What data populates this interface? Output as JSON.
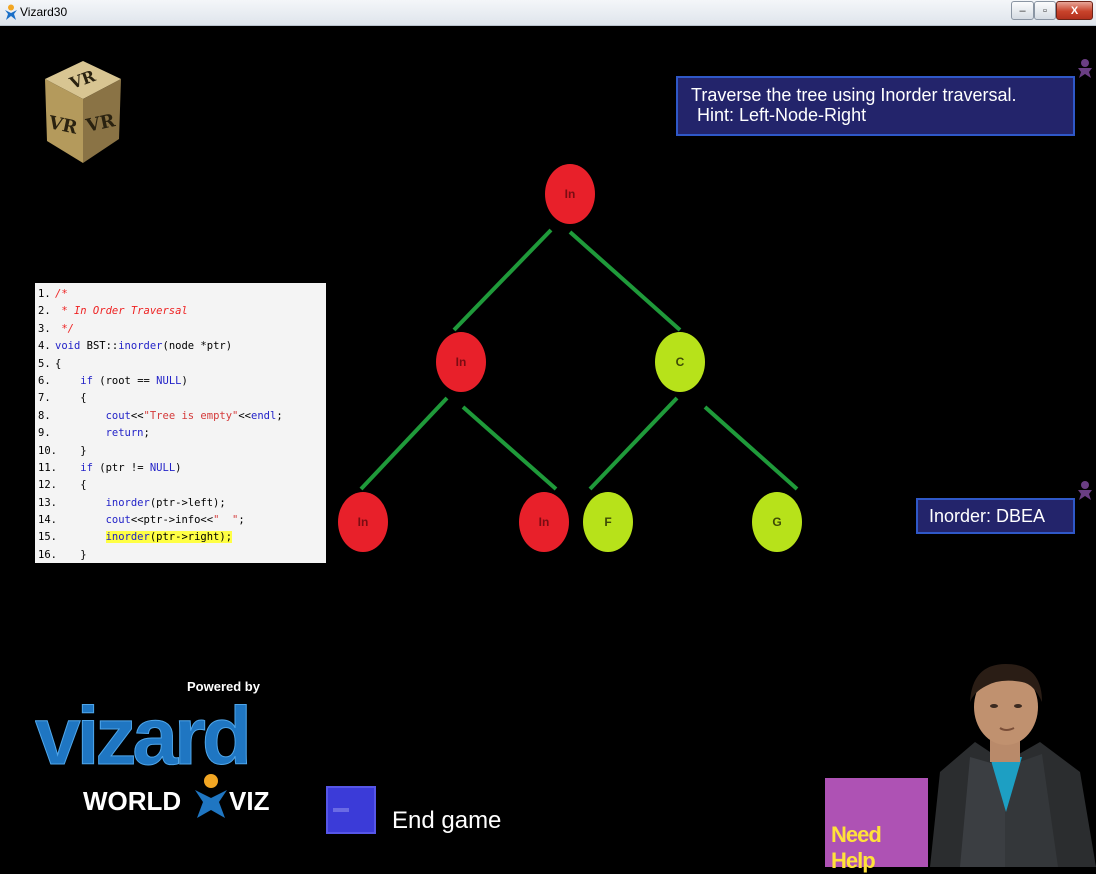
{
  "window": {
    "title": "Vizard30",
    "min_label": "–",
    "restore_label": "▫",
    "close_label": "X"
  },
  "instruction": {
    "line1": "Traverse the tree using Inorder traversal.",
    "line2": "Hint: Left-Node-Right"
  },
  "result": {
    "text": "Inorder: DBEA"
  },
  "code": {
    "lines": [
      {
        "n": "1.",
        "t": "/*"
      },
      {
        "n": "2.",
        "t": " * In Order Traversal"
      },
      {
        "n": "3.",
        "t": " */"
      },
      {
        "n": "4.",
        "t": "void BST::inorder(node *ptr)"
      },
      {
        "n": "5.",
        "t": "{"
      },
      {
        "n": "6.",
        "t": "    if (root == NULL)"
      },
      {
        "n": "7.",
        "t": "    {"
      },
      {
        "n": "8.",
        "t": "        cout<<\"Tree is empty\"<<endl;"
      },
      {
        "n": "9.",
        "t": "        return;"
      },
      {
        "n": "10.",
        "t": "    }"
      },
      {
        "n": "11.",
        "t": "    if (ptr != NULL)"
      },
      {
        "n": "12.",
        "t": "    {"
      },
      {
        "n": "13.",
        "t": "        inorder(ptr->left);"
      },
      {
        "n": "14.",
        "t": "        cout<<ptr->info<<\"  \";"
      },
      {
        "n": "15.",
        "t": "        inorder(ptr->right);"
      },
      {
        "n": "16.",
        "t": "    }"
      }
    ],
    "highlight_line": 15,
    "highlight_color": "#ffff44"
  },
  "tree": {
    "colors": {
      "visited": "#e8202a",
      "pending": "#b7e21a",
      "edge": "#1f9a3a"
    },
    "nodes": [
      {
        "id": "root",
        "label": "In",
        "state": "visited"
      },
      {
        "id": "left",
        "label": "In",
        "state": "visited"
      },
      {
        "id": "right",
        "label": "C",
        "state": "pending"
      },
      {
        "id": "left-left",
        "label": "In",
        "state": "visited"
      },
      {
        "id": "left-right",
        "label": "In",
        "state": "visited"
      },
      {
        "id": "right-left",
        "label": "F",
        "state": "pending"
      },
      {
        "id": "right-right",
        "label": "G",
        "state": "pending"
      }
    ]
  },
  "branding": {
    "powered_by": "Powered by",
    "vizard": "vizard",
    "worldviz_left": "WORLD",
    "worldviz_right": "VIZ"
  },
  "controls": {
    "end_game_label": "End game",
    "need_help_label": "Need Help"
  }
}
